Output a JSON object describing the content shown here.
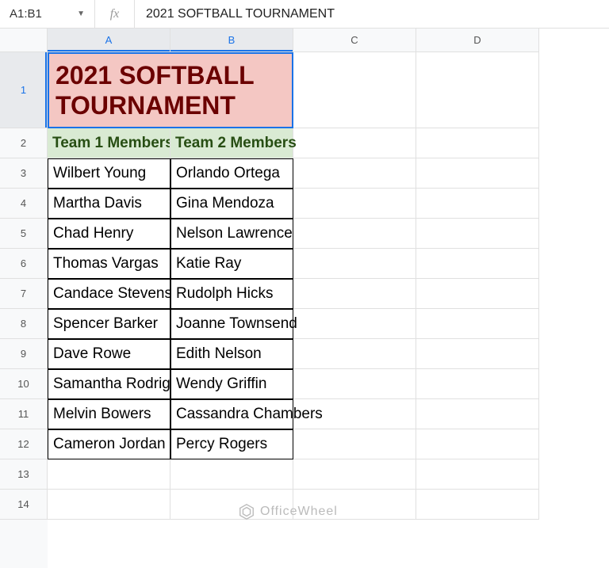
{
  "formula_bar": {
    "name_box": "A1:B1",
    "fx_label": "fx",
    "formula_value": "2021 SOFTBALL TOURNAMENT"
  },
  "columns": [
    "A",
    "B",
    "C",
    "D"
  ],
  "rows": [
    "1",
    "2",
    "3",
    "4",
    "5",
    "6",
    "7",
    "8",
    "9",
    "10",
    "11",
    "12",
    "13",
    "14"
  ],
  "title_cell": "2021 SOFTBALL TOURNAMENT",
  "headers": {
    "team1": "Team 1 Members",
    "team2": "Team 2 Members"
  },
  "team1": [
    "Wilbert Young",
    "Martha Davis",
    "Chad Henry",
    "Thomas Vargas",
    "Candace Stevenson",
    "Spencer Barker",
    "Dave Rowe",
    "Samantha Rodriguez",
    "Melvin Bowers",
    "Cameron Jordan"
  ],
  "team2": [
    "Orlando Ortega",
    "Gina Mendoza",
    "Nelson Lawrence",
    "Katie Ray",
    "Rudolph Hicks",
    "Joanne Townsend",
    "Edith Nelson",
    "Wendy Griffin",
    "Cassandra Chambers",
    "Percy Rogers"
  ],
  "watermark": "OfficeWheel",
  "chart_data": {
    "type": "table",
    "title": "2021 SOFTBALL TOURNAMENT",
    "columns": [
      "Team 1 Members",
      "Team 2 Members"
    ],
    "rows": [
      [
        "Wilbert Young",
        "Orlando Ortega"
      ],
      [
        "Martha Davis",
        "Gina Mendoza"
      ],
      [
        "Chad Henry",
        "Nelson Lawrence"
      ],
      [
        "Thomas Vargas",
        "Katie Ray"
      ],
      [
        "Candace Stevenson",
        "Rudolph Hicks"
      ],
      [
        "Spencer Barker",
        "Joanne Townsend"
      ],
      [
        "Dave Rowe",
        "Edith Nelson"
      ],
      [
        "Samantha Rodriguez",
        "Wendy Griffin"
      ],
      [
        "Melvin Bowers",
        "Cassandra Chambers"
      ],
      [
        "Cameron Jordan",
        "Percy Rogers"
      ]
    ]
  }
}
